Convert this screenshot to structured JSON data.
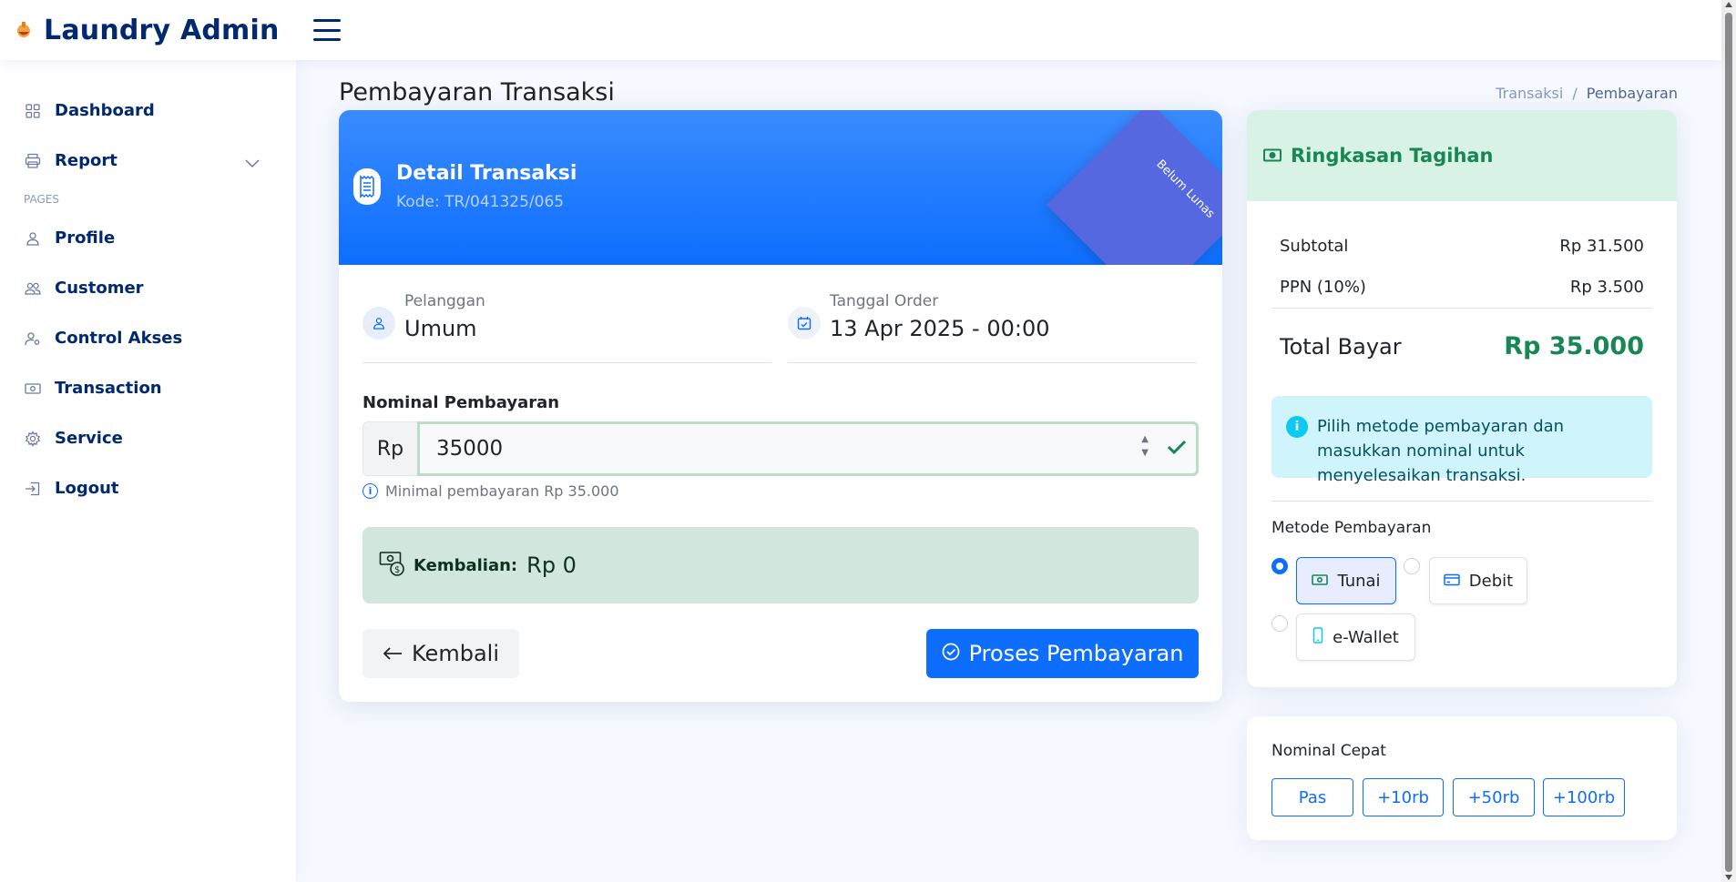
{
  "app": {
    "title": "Laundry Admin"
  },
  "sidebar": {
    "items": [
      {
        "label": "Dashboard",
        "icon": "grid-icon"
      },
      {
        "label": "Report",
        "icon": "printer-icon"
      }
    ],
    "heading": "PAGES",
    "pages": [
      {
        "label": "Profile",
        "icon": "person-icon"
      },
      {
        "label": "Customer",
        "icon": "people-icon"
      },
      {
        "label": "Control Akses",
        "icon": "person-gear-icon"
      },
      {
        "label": "Transaction",
        "icon": "cash-icon"
      },
      {
        "label": "Service",
        "icon": "gear-icon"
      },
      {
        "label": "Logout",
        "icon": "box-arrow-in-right-icon"
      }
    ]
  },
  "page": {
    "title": "Pembayaran Transaksi",
    "breadcrumb": [
      "Transaksi",
      "/",
      "Pembayaran"
    ]
  },
  "detail": {
    "title": "Detail Transaksi",
    "code": "Kode: TR/041325/065",
    "ribbon": "Belum Lunas",
    "customer_label": "Pelanggan",
    "customer_value": "Umum",
    "date_label": "Tanggal Order",
    "date_value": "13 Apr 2025 - 00:00"
  },
  "payment": {
    "label": "Nominal Pembayaran",
    "currency": "Rp",
    "amount": "35000",
    "hint": "Minimal pembayaran Rp 35.000",
    "change_label": "Kembalian:",
    "change_value": "Rp 0",
    "back_label": "Kembali",
    "process_label": "Proses Pembayaran"
  },
  "summary": {
    "title": "Ringkasan Tagihan",
    "subtotal_label": "Subtotal",
    "subtotal_value": "Rp 31.500",
    "tax_label": "PPN (10%)",
    "tax_value": "Rp 3.500",
    "total_label": "Total Bayar",
    "total_value": "Rp 35.000",
    "info": "Pilih metode pembayaran dan masukkan nominal untuk menyelesaikan transaksi.",
    "method_label": "Metode Pembayaran",
    "methods": [
      {
        "label": "Tunai",
        "selected": true
      },
      {
        "label": "Debit",
        "selected": false
      },
      {
        "label": "e-Wallet",
        "selected": false
      }
    ]
  },
  "quick": {
    "label": "Nominal Cepat",
    "buttons": [
      "Pas",
      "+10rb",
      "+50rb",
      "+100rb"
    ]
  },
  "colors": {
    "primary": "#0d6efd",
    "success": "#198754",
    "navy": "#012970",
    "ribbon": "#5668e0"
  }
}
